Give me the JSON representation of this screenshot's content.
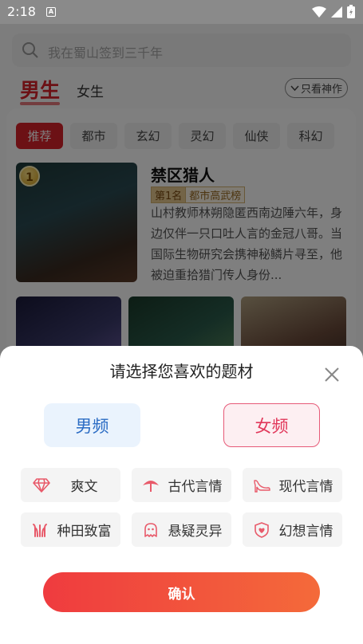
{
  "status_bar": {
    "time": "2:18",
    "notif_icon": "A"
  },
  "search": {
    "placeholder": "我在蜀山签到三千年"
  },
  "gender_tabs": {
    "male": "男生",
    "female": "女生",
    "only_god": "只看神作"
  },
  "categories": [
    "推荐",
    "都市",
    "玄幻",
    "灵幻",
    "仙侠",
    "科幻"
  ],
  "featured_book": {
    "rank": "1",
    "title": "禁区猎人",
    "tag_rank": "第1名",
    "tag_board": "都市高武榜",
    "description": "山村教师林朔隐匿西南边陲六年，身边仅伴一只口吐人言的金冠八哥。当国际生物研究会携神秘鳞片寻至，他被迫重拾猎门传人身份..."
  },
  "sheet": {
    "title": "请选择您喜欢的题材",
    "male_freq": "男频",
    "female_freq": "女频",
    "genres": [
      {
        "label": "爽文",
        "icon": "diamond-icon"
      },
      {
        "label": "古代言情",
        "icon": "parasol-icon"
      },
      {
        "label": "现代言情",
        "icon": "high-heel-icon"
      },
      {
        "label": "种田致富",
        "icon": "wheat-icon"
      },
      {
        "label": "悬疑灵异",
        "icon": "ghost-icon"
      },
      {
        "label": "幻想言情",
        "icon": "shield-heart-icon"
      }
    ],
    "confirm": "确认"
  },
  "colors": {
    "brand_red": "#d9222a",
    "male_blue": "#2b6cc4",
    "female_pink": "#e1375a"
  }
}
